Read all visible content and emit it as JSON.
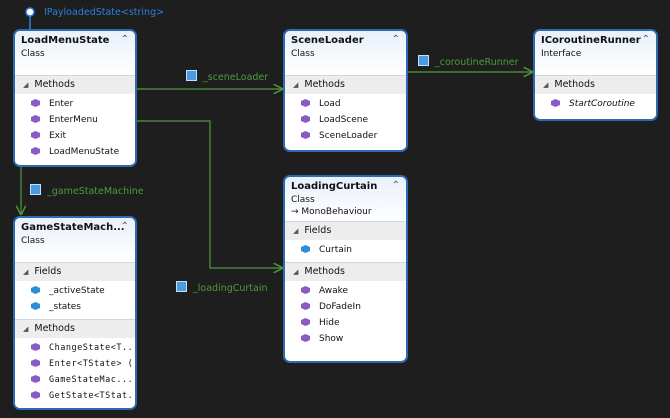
{
  "interface_label": "IPayloadedState<string>",
  "classes": {
    "loadmenu": {
      "name": "LoadMenuState",
      "kind": "Class",
      "sections": [
        {
          "title": "Methods",
          "type": "m",
          "rows": [
            "Enter",
            "EnterMenu",
            "Exit",
            "LoadMenuState"
          ]
        }
      ]
    },
    "sceneloader": {
      "name": "SceneLoader",
      "kind": "Class",
      "sections": [
        {
          "title": "Methods",
          "type": "m",
          "rows": [
            "Load",
            "LoadScene",
            "SceneLoader"
          ]
        }
      ]
    },
    "coroutine": {
      "name": "ICoroutineRunner",
      "kind": "Interface",
      "sections": [
        {
          "title": "Methods",
          "type": "m",
          "italic": true,
          "rows": [
            "StartCoroutine"
          ]
        }
      ]
    },
    "curtain": {
      "name": "LoadingCurtain",
      "kind": "Class",
      "base": "MonoBehaviour",
      "sections": [
        {
          "title": "Fields",
          "type": "f",
          "rows": [
            "Curtain"
          ]
        },
        {
          "title": "Methods",
          "type": "m",
          "rows": [
            "Awake",
            "DoFadeIn",
            "Hide",
            "Show"
          ]
        }
      ]
    },
    "gsm": {
      "name": "GameStateMach...",
      "kind": "Class",
      "sections": [
        {
          "title": "Fields",
          "type": "f",
          "rows": [
            "_activeState",
            "_states"
          ]
        },
        {
          "title": "Methods",
          "type": "m",
          "mono": true,
          "rows": [
            "ChangeState<T...",
            "Enter<TState>  (...",
            "GameStateMac...",
            "GetState<TStat..."
          ]
        }
      ]
    }
  },
  "associations": {
    "scene_loader": "_sceneLoader",
    "coroutine_runner": "_coroutineRunner",
    "game_state_machine": "_gameStateMachine",
    "loading_curtain": "_loadingCurtain"
  },
  "colors": {
    "background": "#1e1e1e",
    "border": "#2c6bb3",
    "connector": "#4e9a3a",
    "interface_label": "#2c7fe0"
  }
}
